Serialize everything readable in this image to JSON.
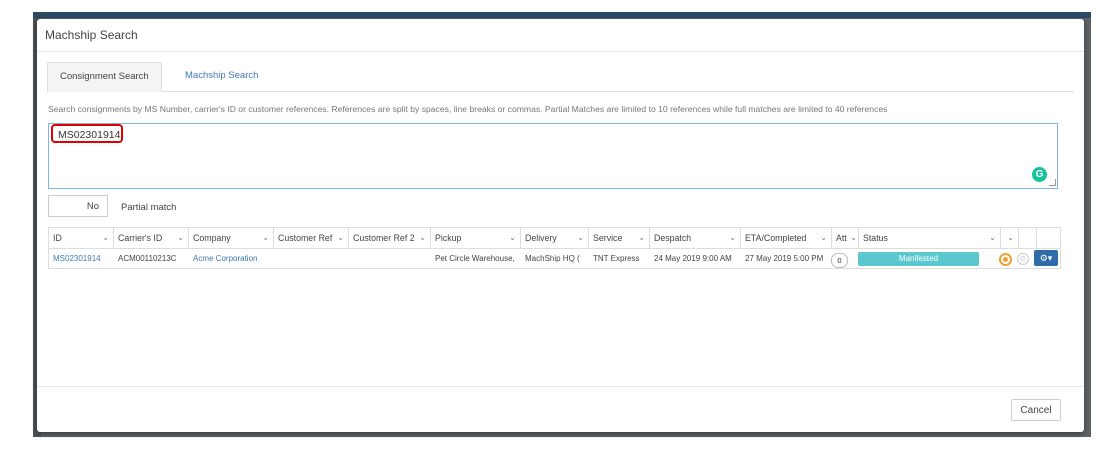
{
  "modal": {
    "title": "Machship Search",
    "tabs": [
      {
        "label": "Consignment Search",
        "active": true
      },
      {
        "label": "Machship Search",
        "active": false
      }
    ],
    "hint": "Search consignments by MS Number, carrier's ID or customer references. References are split by spaces, line breaks or commas. Partial Matches are limited to 10 references while full matches are limited to 40 references",
    "search_value": "MS02301914",
    "grammarly_label": "G",
    "partial_match": {
      "toggle_value": "No",
      "label": "Partial match"
    },
    "cancel_label": "Cancel"
  },
  "grid": {
    "columns": [
      "ID",
      "Carrier's ID",
      "Company",
      "Customer Ref",
      "Customer Ref 2",
      "Pickup",
      "Delivery",
      "Service",
      "Despatch",
      "ETA/Completed",
      "Att",
      "Status"
    ],
    "row": {
      "id": "MS02301914",
      "carrier_id": "ACM00110213C",
      "company": "Acme Corporation",
      "customer_ref": "",
      "customer_ref_2": "",
      "pickup": "Pet Circle Warehouse,",
      "delivery": "MachShip HQ (",
      "service": "TNT Express",
      "despatch": "24 May 2019 9:00 AM",
      "eta": "27 May 2019 5:00 PM",
      "att": "0",
      "status": "Manifested"
    }
  },
  "colors": {
    "accent": "#3d7ab8",
    "status": "#5bc8d0",
    "highlight": "#e00000",
    "action_button": "#2d6ca8"
  }
}
